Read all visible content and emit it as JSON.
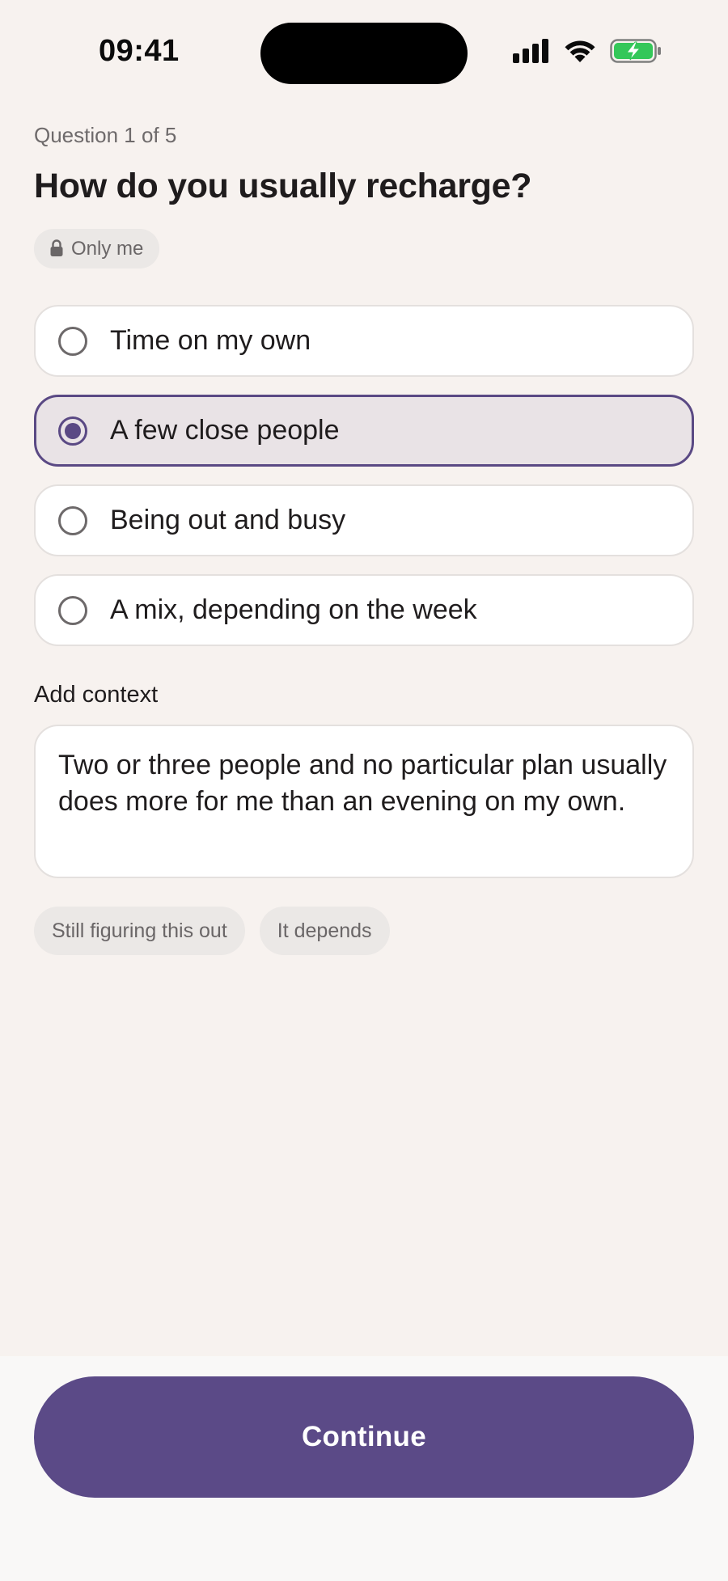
{
  "status_bar": {
    "time": "09:41"
  },
  "header": {
    "progress": "Question 1 of 5",
    "title": "How do you usually recharge?",
    "privacy_label": "Only me"
  },
  "options": [
    {
      "label": "Time on my own",
      "selected": false
    },
    {
      "label": "A few close people",
      "selected": true
    },
    {
      "label": "Being out and busy",
      "selected": false
    },
    {
      "label": "A mix, depending on the week",
      "selected": false
    }
  ],
  "context": {
    "label": "Add context",
    "value": "Two or three people and no particular plan usually does more for me than an evening on my own."
  },
  "suggestions": [
    "Still figuring this out",
    "It depends"
  ],
  "footer": {
    "continue_label": "Continue"
  },
  "colors": {
    "accent": "#5b4a87",
    "background": "#f7f2ef",
    "battery": "#34c759"
  }
}
